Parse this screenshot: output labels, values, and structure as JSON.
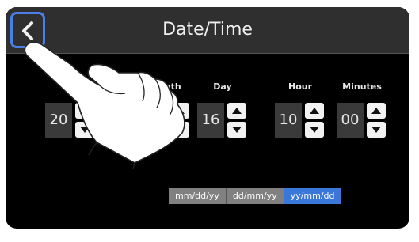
{
  "header": {
    "title": "Date/Time",
    "back_icon": "chevron-left-icon"
  },
  "fields": [
    {
      "id": "year",
      "label": "",
      "value": "20"
    },
    {
      "id": "month",
      "label": "Month",
      "value": ""
    },
    {
      "id": "day",
      "label": "Day",
      "value": "16"
    },
    {
      "id": "hour",
      "label": "Hour",
      "value": "10"
    },
    {
      "id": "minutes",
      "label": "Minutes",
      "value": "00"
    }
  ],
  "format": {
    "options": [
      "mm/dd/yy",
      "dd/mm/yy",
      "yy/mm/dd"
    ],
    "selected": "yy/mm/dd"
  },
  "colors": {
    "accent": "#3b77d9",
    "highlight": "#4a7fe8",
    "header_bg": "#2f2f2f"
  }
}
